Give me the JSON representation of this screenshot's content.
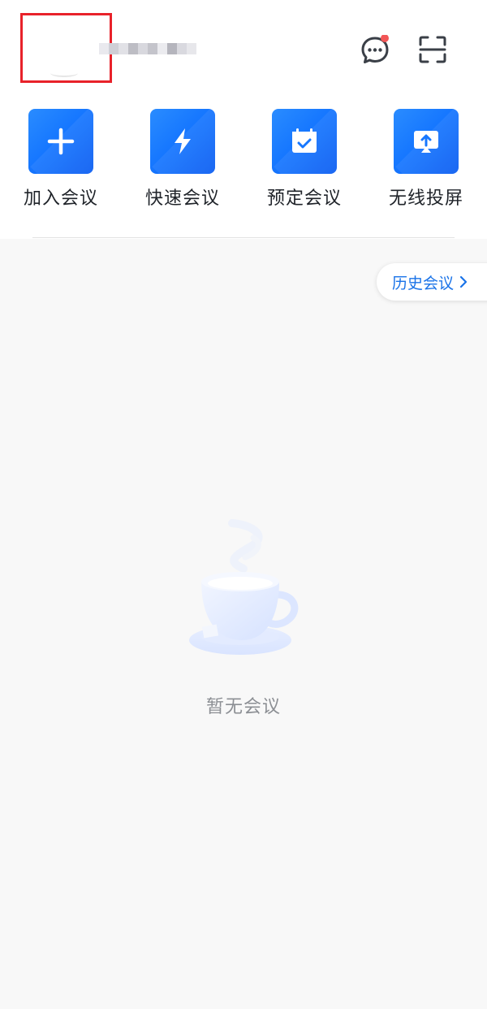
{
  "header": {
    "username_masked": "",
    "message_badge": true,
    "icons": {
      "message": "chat-bubble-icon",
      "scan": "scan-icon"
    }
  },
  "actions": [
    {
      "label": "加入会议",
      "icon": "plus-icon"
    },
    {
      "label": "快速会议",
      "icon": "lightning-icon"
    },
    {
      "label": "预定会议",
      "icon": "calendar-check-icon"
    },
    {
      "label": "无线投屏",
      "icon": "screen-cast-icon"
    }
  ],
  "history": {
    "label": "历史会议"
  },
  "empty_state": {
    "text": "暂无会议",
    "icon": "coffee-cup-icon"
  },
  "colors": {
    "accent": "#1677ff",
    "badge": "#f25656",
    "highlight_box": "#e8222a",
    "background": "#f8f8f8"
  }
}
